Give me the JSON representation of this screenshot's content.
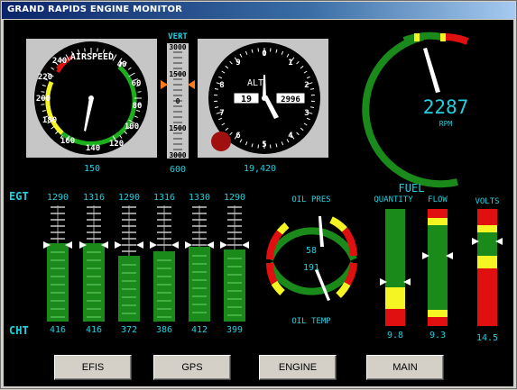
{
  "window": {
    "title": "GRAND RAPIDS ENGINE MONITOR"
  },
  "airspeed": {
    "label": "AIRSPEED",
    "ticks": [
      "40",
      "60",
      "80",
      "100",
      "120",
      "140",
      "160",
      "180",
      "200",
      "220",
      "240"
    ],
    "readout": "150",
    "value": 150
  },
  "vsi": {
    "label": "VERT",
    "ticks": [
      "3000",
      "1500",
      "0",
      "1500",
      "3000"
    ],
    "readout": "600"
  },
  "altimeter": {
    "label": "ALT",
    "digits": [
      "0",
      "1",
      "2",
      "3",
      "4",
      "5",
      "6",
      "7",
      "8",
      "9"
    ],
    "drum_left": "19",
    "drum_right": "2996",
    "readout": "19,420"
  },
  "rpm": {
    "value": "2287",
    "unit": "RPM"
  },
  "egt": {
    "label": "EGT",
    "values": [
      "1290",
      "1316",
      "1290",
      "1316",
      "1330",
      "1290"
    ]
  },
  "cht": {
    "label": "CHT",
    "values": [
      "416",
      "416",
      "372",
      "386",
      "412",
      "399"
    ]
  },
  "oil": {
    "pres_label": "OIL PRES",
    "temp_label": "OIL TEMP",
    "pressure": "58",
    "temperature": "191"
  },
  "fuel": {
    "label": "FUEL",
    "quantity_label": "QUANTITY",
    "flow_label": "FLOW",
    "quantity": "9.8",
    "flow": "9.3"
  },
  "volts": {
    "label": "VOLTS",
    "value": "14.5"
  },
  "buttons": {
    "efis": "EFIS",
    "gps": "GPS",
    "engine": "ENGINE",
    "main": "MAIN"
  }
}
